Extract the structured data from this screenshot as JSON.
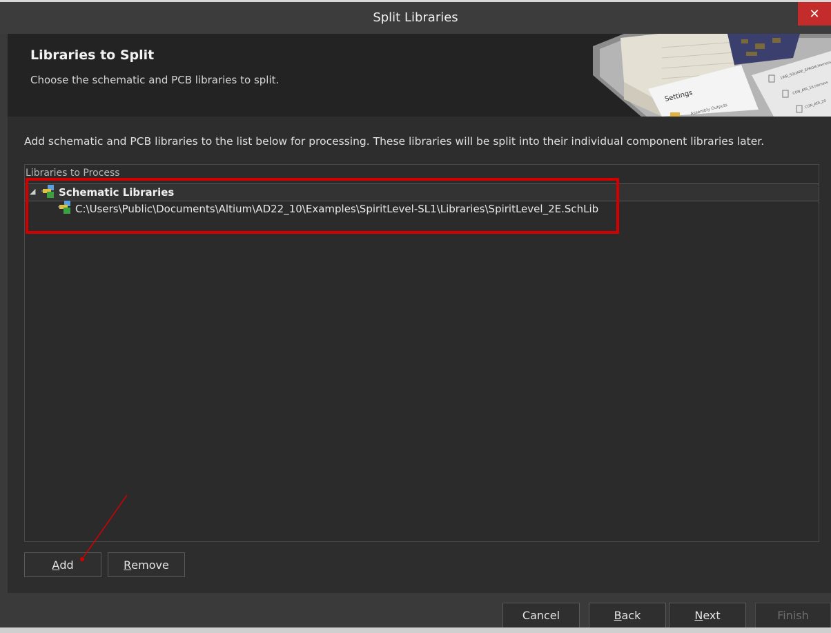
{
  "window": {
    "title": "Split Libraries",
    "close_glyph": "✕"
  },
  "header": {
    "title": "Libraries to Split",
    "subtitle": "Choose the schematic and PCB libraries to split.",
    "art": {
      "settings_label": "Settings",
      "sub_label": "Assembly Outputs",
      "file_1": "1WB_SQUARE_EPROM.Harness",
      "file_2": "CON_ATA_16.Harness",
      "file_3": "CON_ATA_20"
    }
  },
  "instructions": "Add schematic and PCB libraries to the list below for processing. These libraries will be split into their individual component libraries later.",
  "list": {
    "header": "Libraries to Process",
    "groups": [
      {
        "label": "Schematic Libraries",
        "expanded": true,
        "items": [
          "C:\\Users\\Public\\Documents\\Altium\\AD22_10\\Examples\\SpiritLevel-SL1\\Libraries\\SpiritLevel_2E.SchLib"
        ]
      }
    ]
  },
  "buttons": {
    "add": {
      "mnemonic": "A",
      "rest": "dd"
    },
    "remove": {
      "mnemonic": "R",
      "rest": "emove"
    },
    "cancel": "Cancel",
    "back": {
      "mnemonic": "B",
      "rest": "ack"
    },
    "next": {
      "mnemonic": "N",
      "rest": "ext"
    },
    "finish": "Finish"
  },
  "icons": {
    "close": "close-icon",
    "expand": "collapse-triangle-icon",
    "library": "schematic-library-icon"
  },
  "colors": {
    "highlight": "#d40000",
    "close_button": "#c42b2b",
    "panel": "#2d2d2d",
    "header": "#232323"
  }
}
